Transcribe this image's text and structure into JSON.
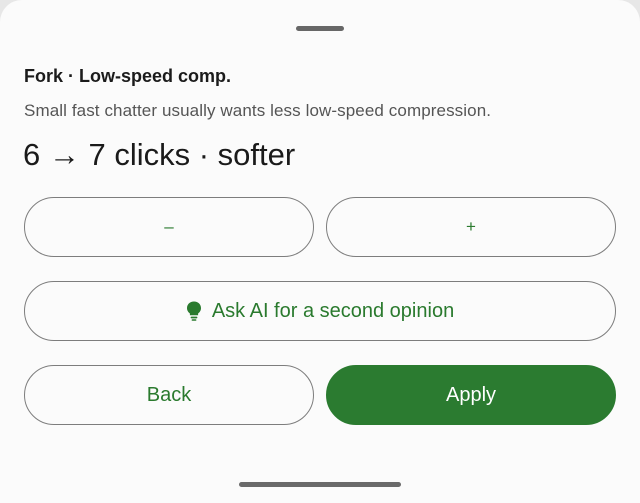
{
  "sheet": {
    "title": "Fork · Low-speed comp.",
    "description": "Small fast chatter usually wants less low-speed compression.",
    "change_summary": "6 → 7 clicks · softer"
  },
  "controls": {
    "decrement_label": "–",
    "increment_label": "+",
    "ask_ai_label": "Ask AI for a second opinion",
    "ask_ai_icon": "lightbulb-icon",
    "back_label": "Back",
    "apply_label": "Apply"
  },
  "colors": {
    "accent": "#2b7b30",
    "accent_text": "#2a7a2e"
  }
}
